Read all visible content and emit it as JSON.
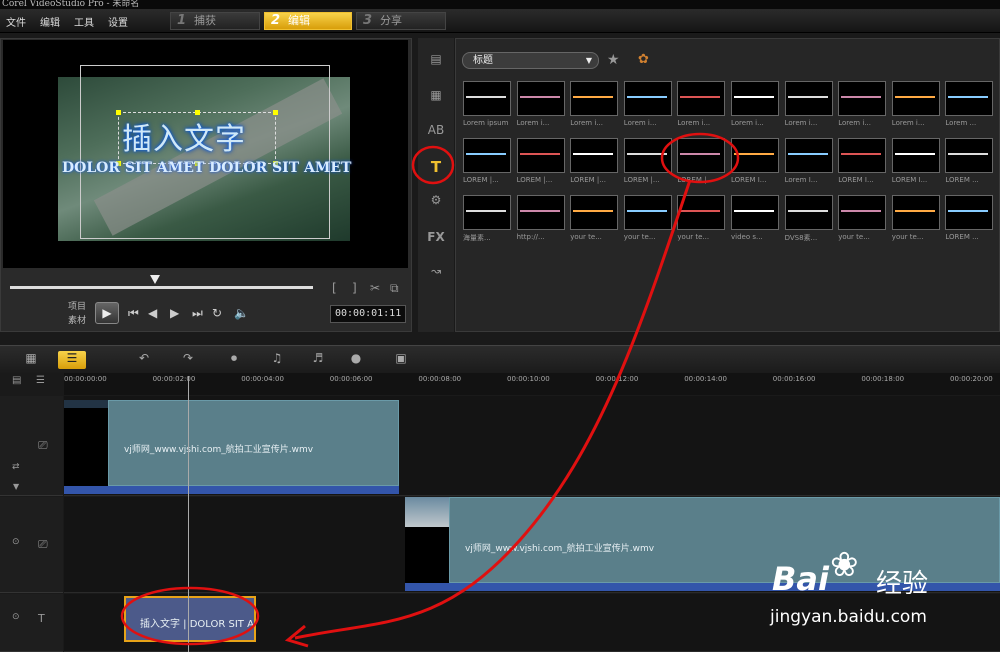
{
  "window": {
    "title": "Corel VideoStudio Pro - 未命名"
  },
  "menu": {
    "items": [
      "文件",
      "编辑",
      "工具",
      "设置"
    ]
  },
  "steps": [
    {
      "num": "1",
      "label": "捕获"
    },
    {
      "num": "2",
      "label": "编辑"
    },
    {
      "num": "3",
      "label": "分享"
    }
  ],
  "preview": {
    "title_text": "插入文字",
    "subtitle_text": "DOLOR SIT AMET DOLOR SIT AMET",
    "mode_project": "项目",
    "mode_clip": "素材",
    "timecode": "00:00:01:11"
  },
  "library": {
    "category": "标题",
    "captions_row1": [
      "Lorem ipsum",
      "Lorem i...",
      "Lorem i...",
      "Lorem i...",
      "Lorem i...",
      "Lorem i...",
      "Lorem i...",
      "Lorem i...",
      "Lorem i...",
      "Lorem ..."
    ],
    "captions_row2": [
      "LOREM |...",
      "LOREM |...",
      "LOREM |...",
      "LOREM |...",
      "LOREM |...",
      "LOREM I...",
      "Lorem I...",
      "LOREM I...",
      "LOREM I...",
      "LOREM ..."
    ],
    "captions_row3": [
      "海量素...",
      "http://...",
      "your te...",
      "your te...",
      "your te...",
      "video s...",
      "DVS8素...",
      "your te...",
      "your te...",
      "LOREM ..."
    ]
  },
  "timeline": {
    "ruler_labels": [
      "00:00:00:00",
      "00:00:02:00",
      "00:00:04:00",
      "00:00:06:00",
      "00:00:08:00",
      "00:00:10:00",
      "00:00:12:00",
      "00:00:14:00",
      "00:00:16:00",
      "00:00:18:00",
      "00:00:20:00"
    ],
    "clip1_label": "vj师网_www.vjshi.com_航拍工业宣传片.wmv",
    "clip2_label": "vj师网_www.vjshi.com_航拍工业宣传片.wmv",
    "title_clip_label": "插入文字 | DOLOR SIT A"
  },
  "watermark": {
    "brand": "Bai",
    "brand2": "经验",
    "url": "jingyan.baidu.com"
  },
  "colors": {
    "accent": "#e7a318",
    "annotation_red": "#e01010",
    "clip": "#5a7f8a"
  }
}
